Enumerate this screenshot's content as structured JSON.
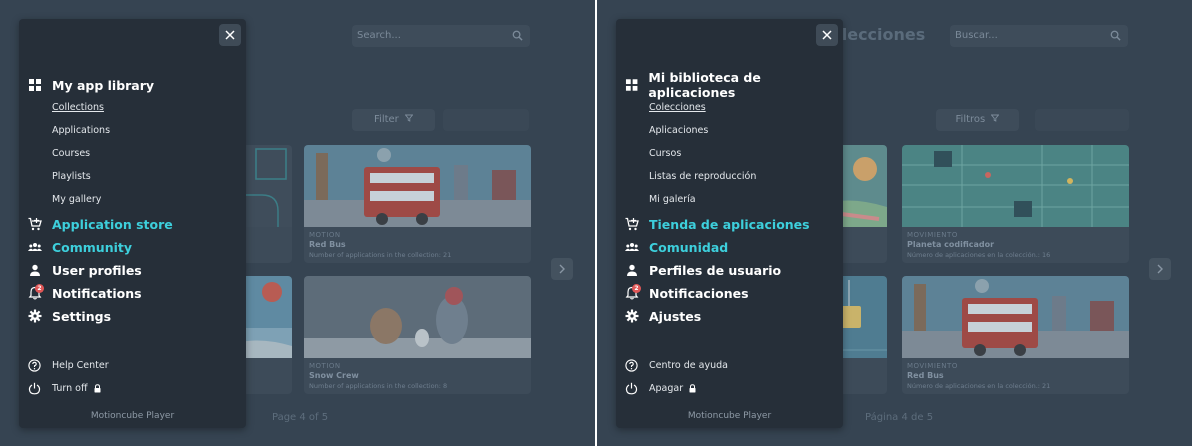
{
  "panels": [
    {
      "lang": "en",
      "background": {
        "title": "",
        "search_placeholder": "Search...",
        "filter_label": "Filter",
        "cards": [
          {
            "category": "MOTION",
            "title": "Red Bus",
            "count": "Number of applications in the collection: 21"
          },
          {
            "category": "MOTION",
            "title": "Snow Crew",
            "count": "Number of applications in the collection: 8"
          }
        ],
        "pager": "Page 4 of 5"
      },
      "drawer": {
        "library": "My app library",
        "sub": [
          "Collections",
          "Applications",
          "Courses",
          "Playlists",
          "My gallery"
        ],
        "store": "Application store",
        "community": "Community",
        "profiles": "User profiles",
        "notifications": "Notifications",
        "notification_count": "2",
        "settings": "Settings",
        "help": "Help Center",
        "turnoff": "Turn off",
        "brand": "Motioncube Player"
      }
    },
    {
      "lang": "es",
      "background": {
        "title": "Colecciones",
        "search_placeholder": "Buscar...",
        "filter_label": "Filtros",
        "cards": [
          {
            "category": "MOVIMIENTO",
            "title": "Planeta codificador",
            "count": "Número de aplicaciones en la colección.: 16"
          },
          {
            "category": "MOVIMIENTO",
            "title": "Red Bus",
            "count": "Número de aplicaciones en la colección.: 21"
          }
        ],
        "pager": "Página 4 de 5"
      },
      "drawer": {
        "library": "Mi biblioteca de aplicaciones",
        "sub": [
          "Colecciones",
          "Aplicaciones",
          "Cursos",
          "Listas de reproducción",
          "Mi galería"
        ],
        "store": "Tienda de aplicaciones",
        "community": "Comunidad",
        "profiles": "Perfiles de usuario",
        "notifications": "Notificaciones",
        "notification_count": "2",
        "settings": "Ajustes",
        "help": "Centro de ayuda",
        "turnoff": "Apagar",
        "brand": "Motioncube Player"
      }
    }
  ],
  "colors": {
    "accent": "#3dcfdc",
    "drawer_bg": "#262f39",
    "page_bg": "#364452",
    "badge": "#e05757"
  }
}
